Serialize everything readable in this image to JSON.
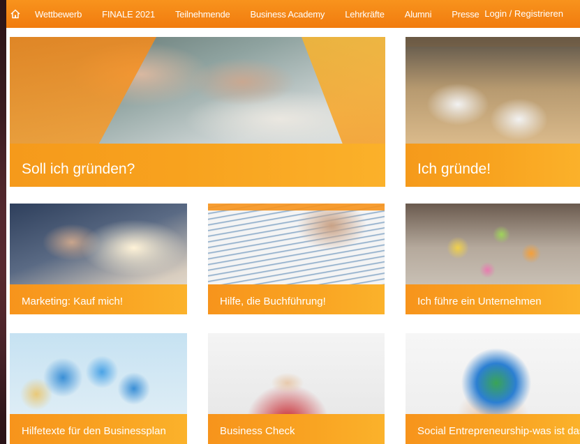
{
  "nav": {
    "home_icon": "home-icon",
    "items": [
      "Wettbewerb",
      "FINALE 2021",
      "Teilnehmende",
      "Business Academy",
      "Lehrkräfte",
      "Alumni",
      "Presse"
    ],
    "login": "Login / Registrieren"
  },
  "tiles": {
    "soll_ich_gruenden": "Soll ich gründen?",
    "ich_gruende": "Ich gründe!",
    "marketing": "Marketing: Kauf mich!",
    "buchfuehrung": "Hilfe, die Buchführung!",
    "unternehmen": "Ich führe ein Unternehmen",
    "hilfetexte": "Hilfetexte für den Businessplan",
    "business_check": "Business Check",
    "social_entrepreneurship": "Social Entrepreneurship-was ist das?"
  },
  "colors": {
    "accent": "#f7931c",
    "nav_bg": "#f17b0e",
    "text_on_accent": "#ffffff"
  }
}
